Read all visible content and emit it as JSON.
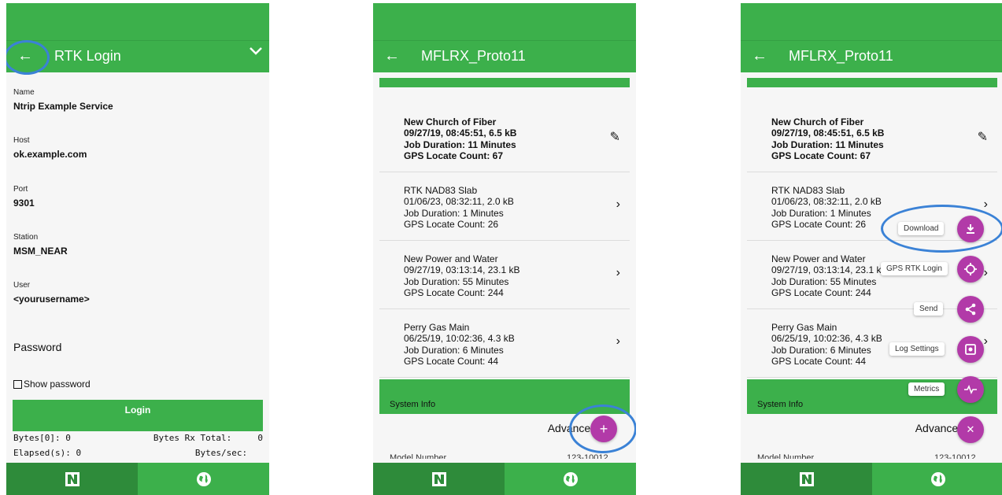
{
  "colors": {
    "green": "#3cb04b",
    "dark_green": "#2e8b3a",
    "fab": "#b23aa8",
    "highlight": "#3b82d6"
  },
  "panel1": {
    "title": "RTK Login",
    "fields": [
      {
        "label": "Name",
        "value": "Ntrip Example Service"
      },
      {
        "label": "Host",
        "value": "ok.example.com"
      },
      {
        "label": "Port",
        "value": "9301"
      },
      {
        "label": "Station",
        "value": "MSM_NEAR"
      },
      {
        "label": "User",
        "value": "<yourusername>"
      }
    ],
    "password_placeholder": "Password",
    "show_password": "Show password",
    "login_label": "Login",
    "stats": [
      {
        "left": "Bytes[0]: 0",
        "right": "Bytes Rx Total:     0"
      },
      {
        "left": "Elapsed(s): 0",
        "right": "Bytes/sec:   "
      }
    ]
  },
  "jobs_title": "MFLRX_Proto11",
  "jobs": [
    {
      "name": "New Church of Fiber",
      "meta": "09/27/19, 08:45:51, 6.5 kB",
      "duration": "Job Duration: 11 Minutes",
      "gps": "GPS Locate Count: 67",
      "icon": "pencil-icon"
    },
    {
      "name": "RTK NAD83 Slab",
      "meta": "01/06/23, 08:32:11, 2.0 kB",
      "duration": "Job Duration: 1 Minutes",
      "gps": "GPS Locate Count: 26",
      "icon": "chevron-right-icon"
    },
    {
      "name": "New Power and Water",
      "meta": "09/27/19, 03:13:14, 23.1 kB",
      "duration": "Job Duration: 55 Minutes",
      "gps": "GPS Locate Count: 244",
      "icon": "chevron-right-icon"
    },
    {
      "name": "Perry Gas Main",
      "meta": "06/25/19, 10:02:36, 4.3 kB",
      "duration": "Job Duration: 6 Minutes",
      "gps": "GPS Locate Count: 44",
      "icon": "chevron-right-icon"
    }
  ],
  "system_info": "System Info",
  "advanced": "Advanced",
  "model_number_cut": "Model Number",
  "model_value_cut": "123-10012",
  "panel3_menu": [
    "Download",
    "GPS RTK Login",
    "Send",
    "Log Settings",
    "Metrics"
  ],
  "symbols": {
    "back": "←",
    "pencil": "✎",
    "chevron": "›",
    "plus": "+",
    "close": "✕"
  }
}
